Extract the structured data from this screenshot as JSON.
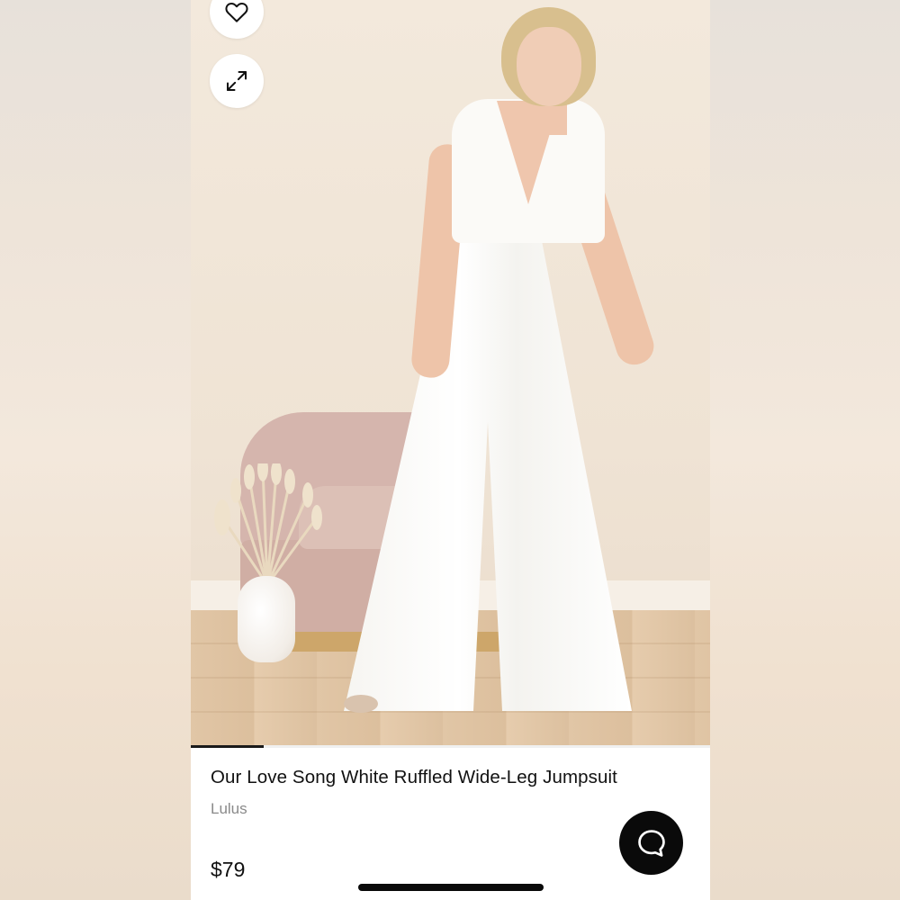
{
  "product": {
    "title": "Our Love Song White Ruffled Wide-Leg Jumpsuit",
    "brand": "Lulus",
    "price": "$79"
  },
  "gallery": {
    "image_alt": "",
    "progress": 0.14
  },
  "icons": {
    "favorite": "heart-icon",
    "expand": "expand-icon",
    "chat": "chat-bubble-icon"
  },
  "colors": {
    "text_primary": "#111111",
    "text_secondary": "#8a8a8a",
    "chat_button": "#0a0a0a",
    "background": "#ffffff"
  }
}
